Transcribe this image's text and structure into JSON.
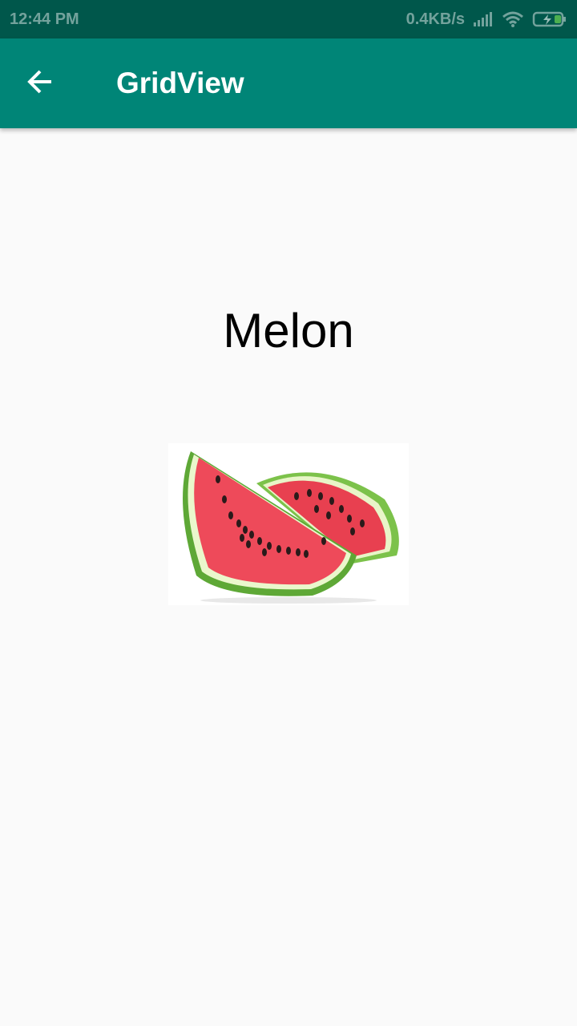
{
  "status_bar": {
    "time": "12:44 PM",
    "network_speed": "0.4KB/s",
    "signal_icon": "signal-icon",
    "wifi_icon": "wifi-icon",
    "battery_icon": "battery-charging-icon"
  },
  "app_bar": {
    "back_icon": "arrow-back-icon",
    "title": "GridView",
    "background": "#008577"
  },
  "content": {
    "item_name": "Melon",
    "image": "watermelon-slices-image"
  },
  "colors": {
    "status_bar": "#00574b",
    "app_bar": "#008577",
    "background": "#fafafa"
  }
}
